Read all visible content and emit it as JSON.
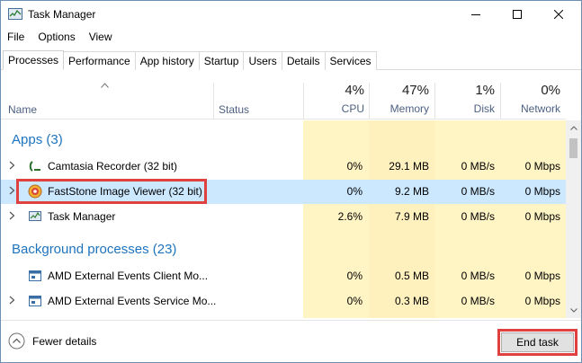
{
  "window": {
    "title": "Task Manager"
  },
  "menu": [
    "File",
    "Options",
    "View"
  ],
  "tabs": [
    "Processes",
    "Performance",
    "App history",
    "Startup",
    "Users",
    "Details",
    "Services"
  ],
  "active_tab": "Processes",
  "columns": {
    "name": "Name",
    "status": "Status",
    "cpu": {
      "pct": "4%",
      "label": "CPU"
    },
    "memory": {
      "pct": "47%",
      "label": "Memory"
    },
    "disk": {
      "pct": "1%",
      "label": "Disk"
    },
    "network": {
      "pct": "0%",
      "label": "Network"
    }
  },
  "groups": {
    "apps": "Apps (3)",
    "background": "Background processes (23)"
  },
  "apps": [
    {
      "name": "Camtasia Recorder (32 bit)",
      "cpu": "0%",
      "memory": "29.1 MB",
      "disk": "0 MB/s",
      "network": "0 Mbps",
      "icon": "camtasia-icon"
    },
    {
      "name": "FastStone Image Viewer (32 bit)",
      "cpu": "0%",
      "memory": "9.2 MB",
      "disk": "0 MB/s",
      "network": "0 Mbps",
      "icon": "faststone-icon"
    },
    {
      "name": "Task Manager",
      "cpu": "2.6%",
      "memory": "7.9 MB",
      "disk": "0 MB/s",
      "network": "0 Mbps",
      "icon": "taskmanager-icon"
    }
  ],
  "background": [
    {
      "name": "AMD External Events Client Mo...",
      "cpu": "0%",
      "memory": "0.5 MB",
      "disk": "0 MB/s",
      "network": "0 Mbps",
      "icon": "service-icon"
    },
    {
      "name": "AMD External Events Service Mo...",
      "cpu": "0%",
      "memory": "0.3 MB",
      "disk": "0 MB/s",
      "network": "0 Mbps",
      "icon": "service-icon"
    }
  ],
  "footer": {
    "fewer_details": "Fewer details",
    "end_task": "End task"
  },
  "colors": {
    "heat": "#fff4c4",
    "selected": "#cce8ff",
    "group": "#1e73be",
    "highlight": "#e04040"
  }
}
